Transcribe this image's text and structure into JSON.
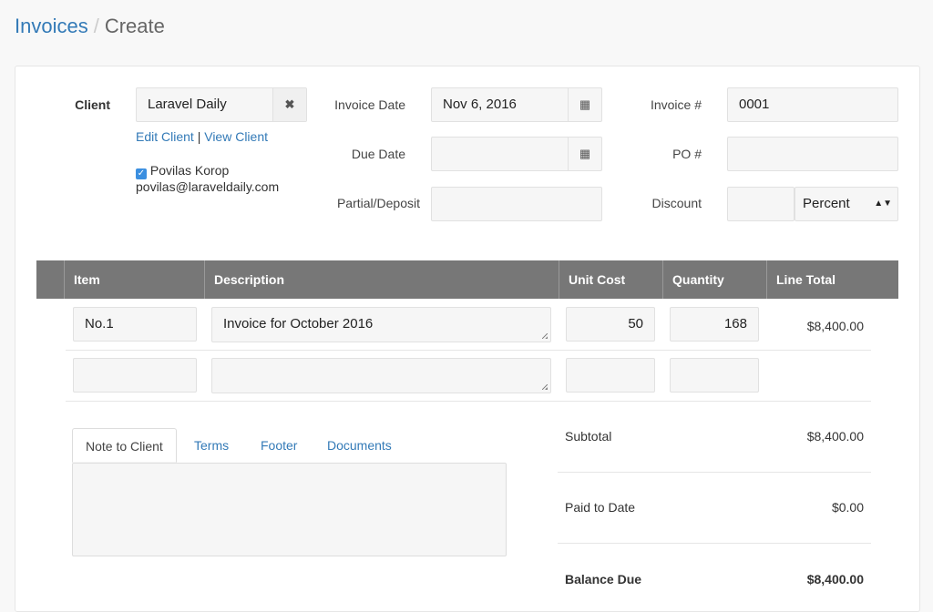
{
  "breadcrumb": {
    "parent": "Invoices",
    "current": "Create"
  },
  "client": {
    "label": "Client",
    "value": "Laravel Daily",
    "edit": "Edit Client",
    "sep": "|",
    "view": "View Client",
    "contact_name": "Povilas Korop",
    "contact_email": "povilas@laraveldaily.com",
    "contact_checked": true
  },
  "dates": {
    "invoice_date_label": "Invoice Date",
    "invoice_date": "Nov 6, 2016",
    "due_date_label": "Due Date",
    "due_date": "",
    "partial_label": "Partial/Deposit",
    "partial": ""
  },
  "meta": {
    "invoice_no_label": "Invoice #",
    "invoice_no": "0001",
    "po_label": "PO #",
    "po": "",
    "discount_label": "Discount",
    "discount": "",
    "discount_type": "Percent"
  },
  "table": {
    "headers": [
      "Item",
      "Description",
      "Unit Cost",
      "Quantity",
      "Line Total"
    ],
    "rows": [
      {
        "item": "No.1",
        "description": "Invoice for October 2016",
        "unit_cost": "50",
        "quantity": "168",
        "line_total": "$8,400.00"
      },
      {
        "item": "",
        "description": "",
        "unit_cost": "",
        "quantity": "",
        "line_total": ""
      }
    ]
  },
  "tabs": [
    "Note to Client",
    "Terms",
    "Footer",
    "Documents"
  ],
  "totals": {
    "subtotal_label": "Subtotal",
    "subtotal": "$8,400.00",
    "paid_label": "Paid to Date",
    "paid": "$0.00",
    "balance_label": "Balance Due",
    "balance": "$8,400.00"
  }
}
